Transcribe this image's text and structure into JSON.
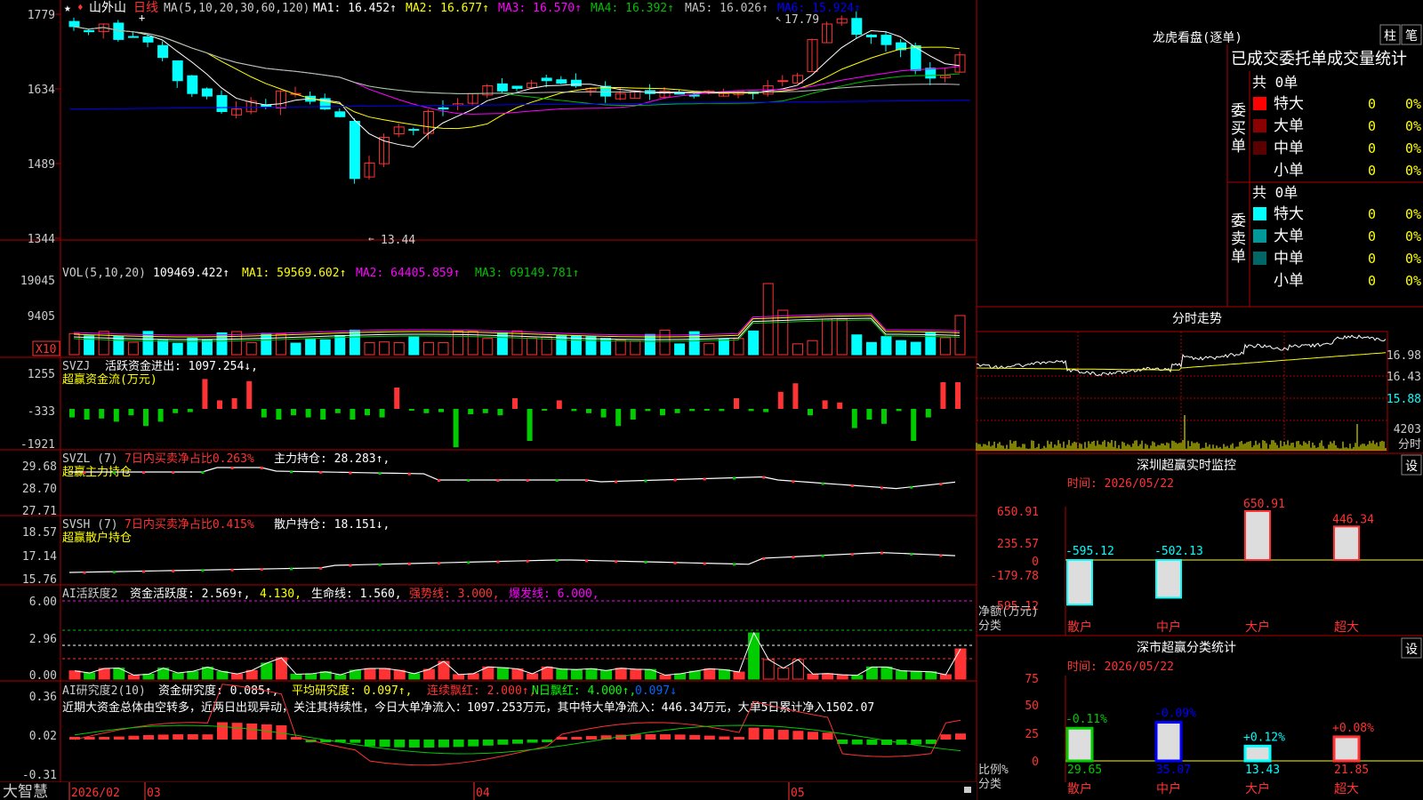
{
  "colors": {
    "up": "#ff3333",
    "down": "#00ffff",
    "grid": "#b00000",
    "ma1": "#ffffff",
    "ma2": "#ffff00",
    "ma3": "#ff00ff",
    "ma4": "#00c000",
    "ma5": "#c0c0c0",
    "ma6": "#0000ff",
    "yellow": "#ffff00",
    "bg": "#000000"
  },
  "icons": {
    "star": "★",
    "marker": "+"
  },
  "header": {
    "stock_name": "山外山",
    "period": "日线",
    "ma_params": "MA(5,10,20,30,60,120)",
    "ma_values": [
      {
        "label": "MA1: 16.452↑",
        "color": "#ffffff"
      },
      {
        "label": "MA2: 16.677↑",
        "color": "#ffff00"
      },
      {
        "label": "MA3: 16.570↑",
        "color": "#ff00ff"
      },
      {
        "label": "MA4: 16.392↑",
        "color": "#00c000"
      },
      {
        "label": "MA5: 16.026↑",
        "color": "#c0c0c0"
      },
      {
        "label": "MA6: 15.924↑",
        "color": "#0000ff"
      }
    ]
  },
  "price_axis": [
    "1779",
    "1634",
    "1489",
    "1344"
  ],
  "price_annotations": {
    "high": "17.79",
    "low": "13.44"
  },
  "vol": {
    "title": "VOL(5,10,20)",
    "value": "109469.422↑",
    "ma1": "MA1: 59569.602↑",
    "ma2": "MA2: 64405.859↑",
    "ma3": "MA3: 69149.781↑",
    "axis": [
      "19045",
      "9405"
    ],
    "unit": "X10"
  },
  "svzj": {
    "title": "SVZJ",
    "desc": "活跃资金进出: 1097.254↓,",
    "sub": "超赢资金流(万元)",
    "axis": [
      "1255",
      "-333",
      "-1921"
    ]
  },
  "svzl": {
    "title": "SVZL (7)",
    "pct": "7日内买卖净占比0.263%",
    "hold": "主力持仓: 28.283↑,",
    "sub": "超赢主力持仓",
    "axis": [
      "29.68",
      "28.70",
      "27.71"
    ]
  },
  "svsh": {
    "title": "SVSH (7)",
    "pct": "7日内买卖净占比0.415%",
    "hold": "散户持仓: 18.151↓,",
    "sub": "超赢散户持仓",
    "axis": [
      "18.57",
      "17.14",
      "15.76"
    ]
  },
  "ai1": {
    "title": "AI活跃度2",
    "a": "资金活跃度: 2.569↑,",
    "b": "4.130,",
    "c": "生命线: 1.560,",
    "d": "强势线: 3.000,",
    "e": "爆发线: 6.000,",
    "axis": [
      "6.00",
      "2.96",
      "0.00"
    ]
  },
  "ai2": {
    "title": "AI研究度2(10)",
    "a": "资金研究度: 0.085↑,",
    "b": "平均研究度: 0.097↑,",
    "c": "连续飘红: 2.000↑,",
    "d": "N日飘红: 4.000↑,",
    "e": "0.097↓",
    "axis": [
      "0.36",
      "0.02",
      "-0.31"
    ],
    "comment": "近期大资金总体由空转多，近两日出现异动，关注其持续性，今日大单净流入：1097.253万元，其中特大单净流入：446.34万元，大单5日累计净入1502.07"
  },
  "time_axis": {
    "start": "2026/02",
    "m1": "03",
    "m2": "04",
    "m3": "05"
  },
  "footer_brand": "大智慧",
  "right": {
    "title": "龙虎看盘(逐单)",
    "btn1": "柱",
    "btn2": "笔",
    "table_header": "已成交委托单成交量统计",
    "buy_label": "委买单",
    "sell_label": "委卖单",
    "buy_total": "共 0单",
    "sell_total": "共 0单",
    "buy_rows": [
      {
        "name": "特大",
        "n": "0",
        "p": "0%",
        "color": "#ff0000"
      },
      {
        "name": "大单",
        "n": "0",
        "p": "0%",
        "color": "#8b0000"
      },
      {
        "name": "中单",
        "n": "0",
        "p": "0%",
        "color": "#5a0000"
      },
      {
        "name": "小单",
        "n": "0",
        "p": "0%",
        "color": "#000000"
      }
    ],
    "sell_rows": [
      {
        "name": "特大",
        "n": "0",
        "p": "0%",
        "color": "#00ffff"
      },
      {
        "name": "大单",
        "n": "0",
        "p": "0%",
        "color": "#009999"
      },
      {
        "name": "中单",
        "n": "0",
        "p": "0%",
        "color": "#006666"
      },
      {
        "name": "小单",
        "n": "0",
        "p": "0%",
        "color": "#000000"
      }
    ],
    "intraday": {
      "title": "分时走势",
      "axis": [
        "16.98",
        "16.43",
        "15.88"
      ],
      "vol_label": "4203",
      "vol_unit": "分时"
    },
    "monitor": {
      "title": "深圳超赢实时监控",
      "btn": "设",
      "time": "时间: 2026/05/22",
      "axis": [
        "650.91",
        "235.57",
        "0",
        "-179.78",
        "-595.12"
      ],
      "ylabel": "净额(万元)",
      "xlabel": "分类",
      "bars": [
        {
          "cat": "散户",
          "val": "-595.12"
        },
        {
          "cat": "中户",
          "val": "-502.13"
        },
        {
          "cat": "大户",
          "val": "650.91"
        },
        {
          "cat": "超大",
          "val": "446.34"
        }
      ]
    },
    "stats": {
      "title": "深市超赢分类统计",
      "btn": "设",
      "time": "时间: 2026/05/22",
      "axis": [
        "75",
        "50",
        "25",
        "0"
      ],
      "ylabel": "比例%",
      "xlabel": "分类",
      "bars": [
        {
          "cat": "散户",
          "val": "29.65",
          "chg": "-0.11%"
        },
        {
          "cat": "中户",
          "val": "35.07",
          "chg": "-0.09%"
        },
        {
          "cat": "大户",
          "val": "13.43",
          "chg": "+0.12%"
        },
        {
          "cat": "超大",
          "val": "21.85",
          "chg": "+0.08%"
        }
      ]
    }
  }
}
